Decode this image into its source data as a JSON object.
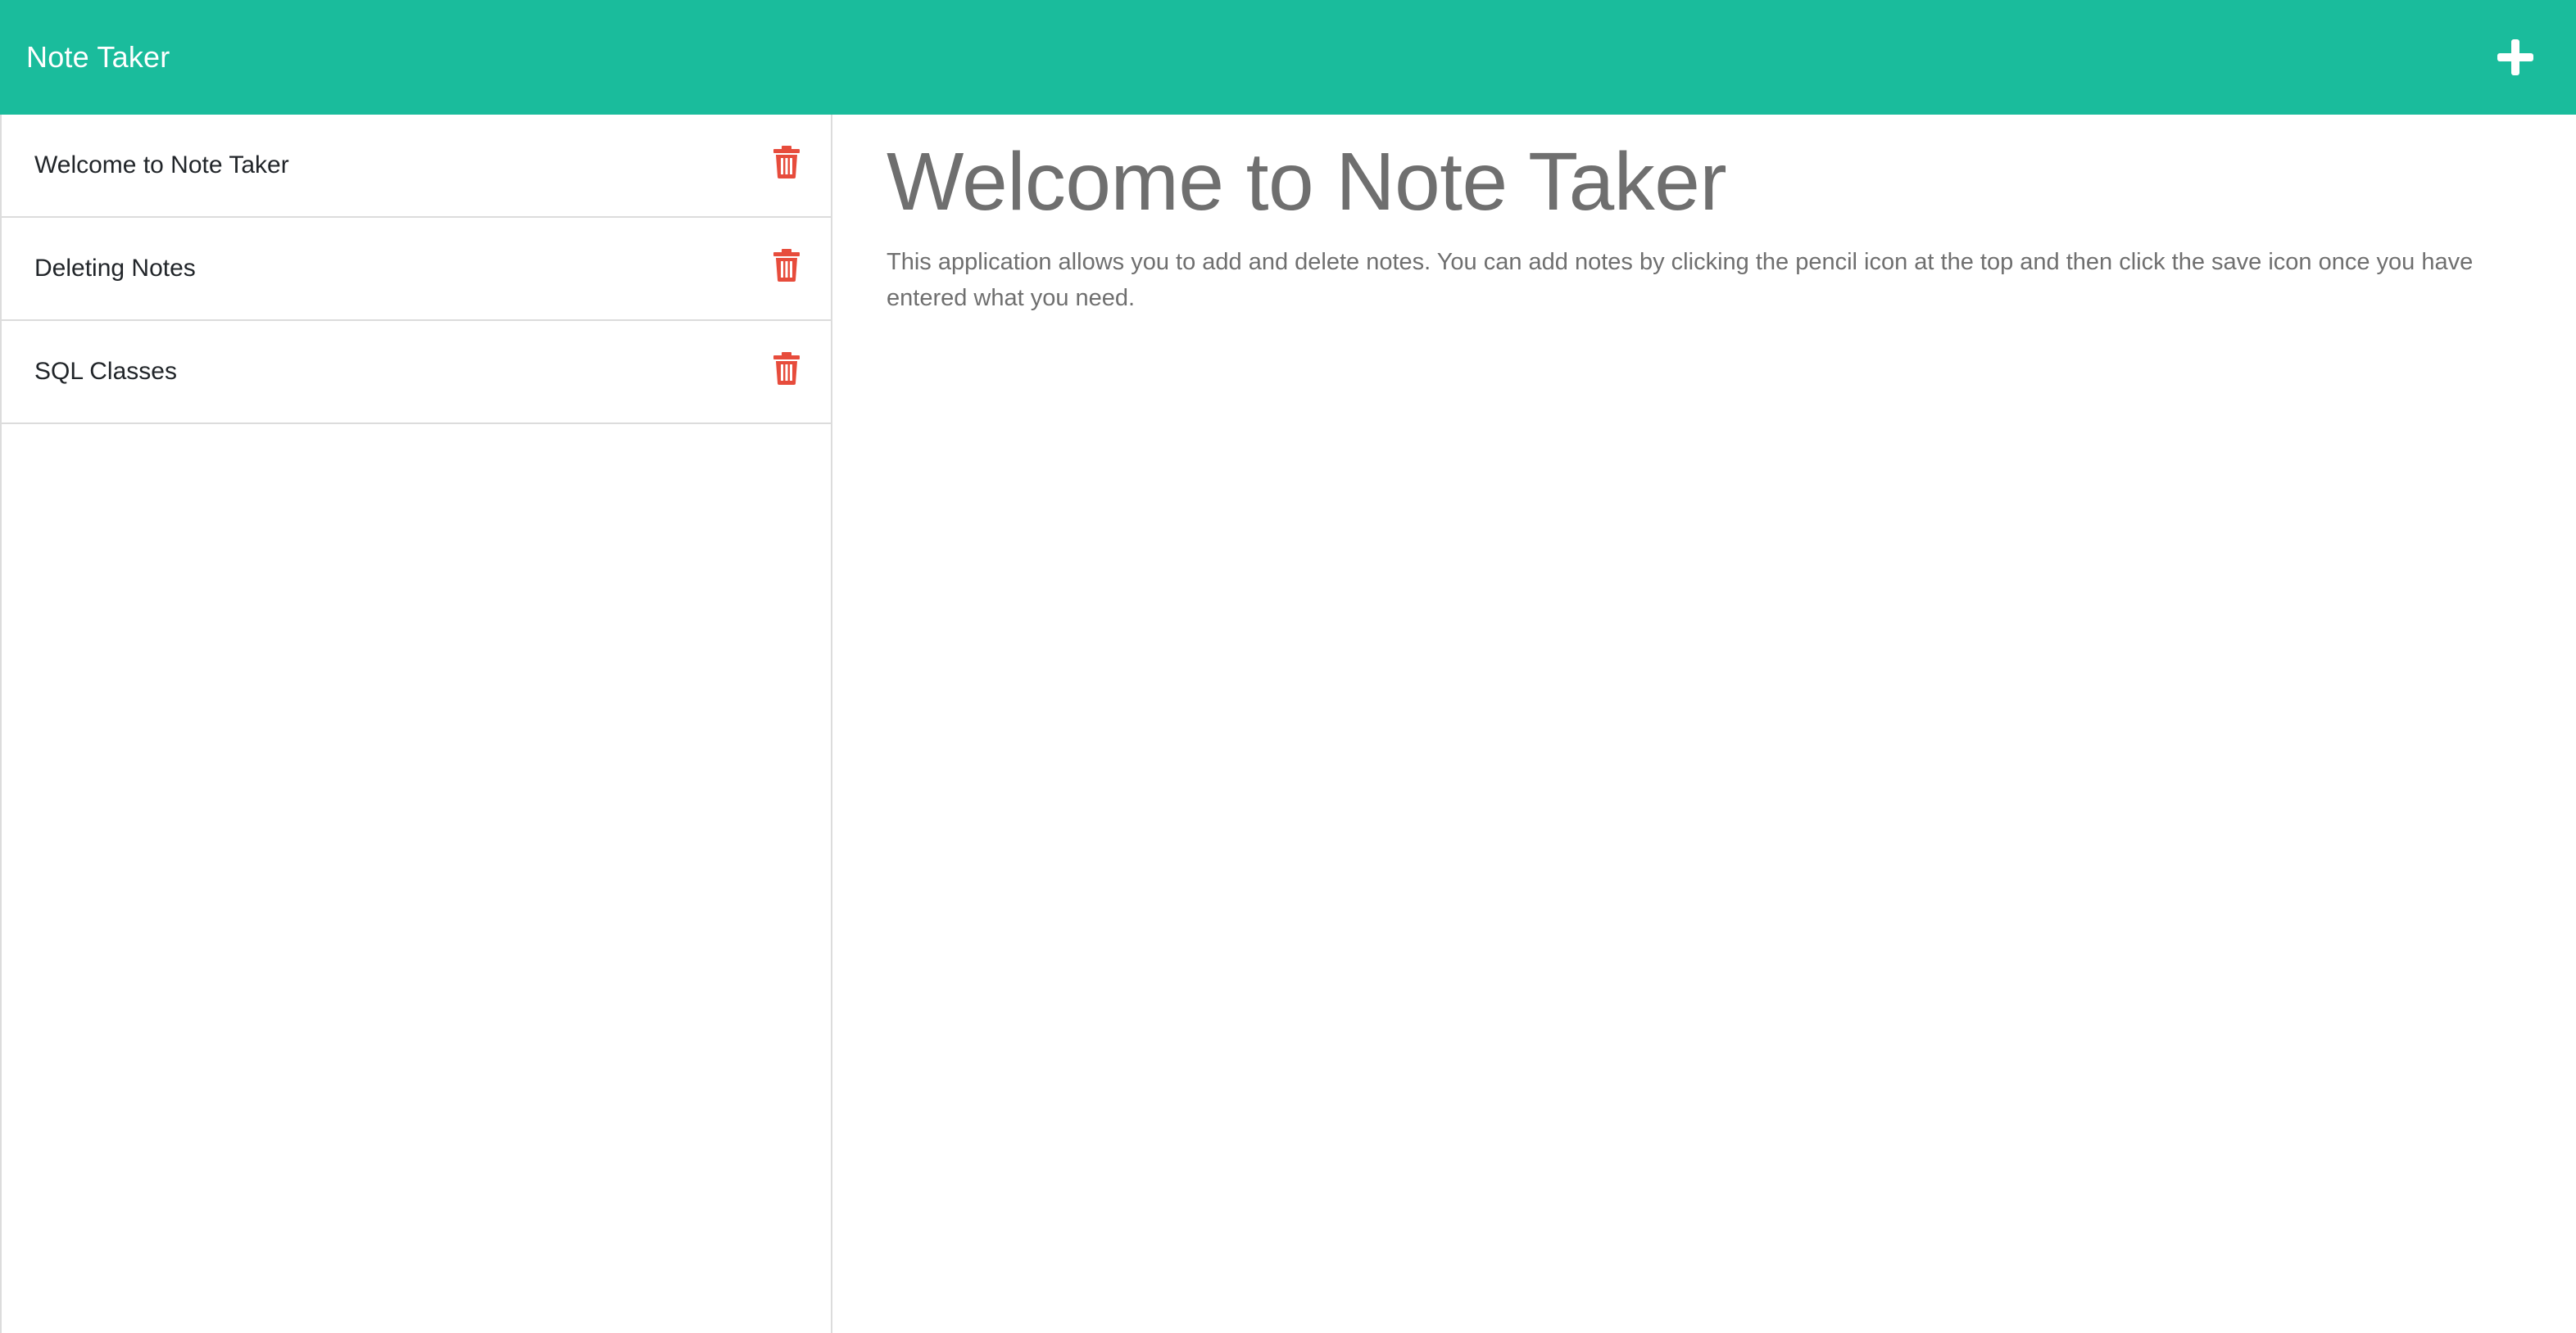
{
  "navbar": {
    "brand": "Note Taker",
    "add_icon": "plus-icon",
    "background_color": "#1abc9c"
  },
  "sidebar": {
    "notes": [
      {
        "title": "Welcome to Note Taker",
        "delete_icon": "trash-icon"
      },
      {
        "title": "Deleting Notes",
        "delete_icon": "trash-icon"
      },
      {
        "title": "SQL Classes",
        "delete_icon": "trash-icon"
      }
    ],
    "delete_color": "#e74c3c"
  },
  "main": {
    "title": "Welcome to Note Taker",
    "body": "This application allows you to add and delete notes. You can add notes by clicking the pencil icon at the top and then click the save icon once you have entered what you need."
  }
}
